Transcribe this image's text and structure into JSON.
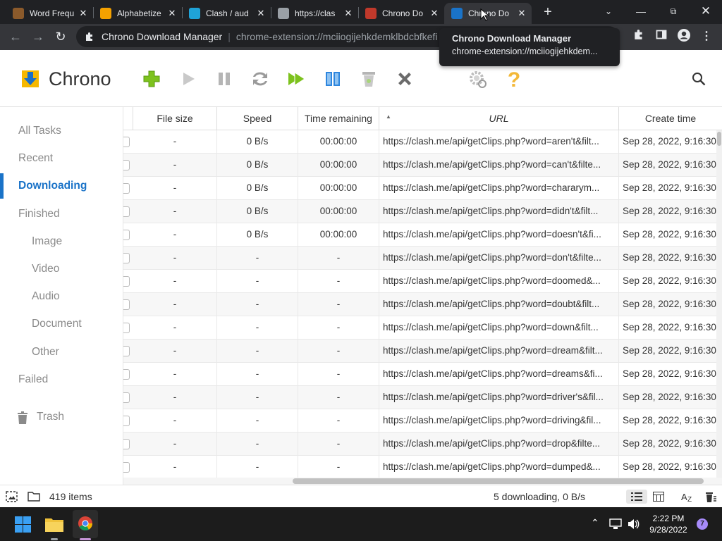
{
  "browser": {
    "tabs": [
      {
        "title": "Word Frequ",
        "icon": "word-frequency-favicon",
        "color": "#8b5a2b"
      },
      {
        "title": "Alphabetize",
        "icon": "alphabetize-favicon",
        "color": "#f4a100"
      },
      {
        "title": "Clash / aud",
        "icon": "clash-favicon",
        "color": "#1fa3d8"
      },
      {
        "title": "https://clas",
        "icon": "globe-favicon",
        "color": "#9aa0a6"
      },
      {
        "title": "Chrono Do",
        "icon": "chrono-favicon-red",
        "color": "#c0392b"
      },
      {
        "title": "Chrono Do",
        "icon": "chrono-favicon",
        "color": "#1a73c8"
      }
    ],
    "new_tab": "+",
    "omnibox": {
      "site": "Chrono Download Manager",
      "url": "chrome-extension://mciiogijehkdemklbdcbfkefi"
    }
  },
  "tooltip": {
    "title": "Chrono Download Manager",
    "url": "chrome-extension://mciiogijehkdem..."
  },
  "app": {
    "title": "Chrono",
    "actions": [
      "add",
      "start",
      "pause",
      "restart",
      "start-all",
      "columns",
      "clean",
      "delete",
      "settings",
      "help"
    ]
  },
  "sidebar": {
    "items": [
      {
        "label": "All Tasks",
        "sub": false,
        "active": false
      },
      {
        "label": "Recent",
        "sub": false,
        "active": false
      },
      {
        "label": "Downloading",
        "sub": false,
        "active": true
      },
      {
        "label": "Finished",
        "sub": false,
        "active": false
      },
      {
        "label": "Image",
        "sub": true,
        "active": false
      },
      {
        "label": "Video",
        "sub": true,
        "active": false
      },
      {
        "label": "Audio",
        "sub": true,
        "active": false
      },
      {
        "label": "Document",
        "sub": true,
        "active": false
      },
      {
        "label": "Other",
        "sub": true,
        "active": false
      },
      {
        "label": "Failed",
        "sub": false,
        "active": false
      }
    ],
    "trash": "Trash"
  },
  "table": {
    "columns": [
      "File size",
      "Speed",
      "Time remaining",
      "URL",
      "Create time"
    ],
    "rows": [
      {
        "size": "-",
        "speed": "0 B/s",
        "remaining": "00:00:00",
        "url": "https://clash.me/api/getClips.php?word=aren't&filt...",
        "created": "Sep 28, 2022, 9:16:30"
      },
      {
        "size": "-",
        "speed": "0 B/s",
        "remaining": "00:00:00",
        "url": "https://clash.me/api/getClips.php?word=can't&filte...",
        "created": "Sep 28, 2022, 9:16:30"
      },
      {
        "size": "-",
        "speed": "0 B/s",
        "remaining": "00:00:00",
        "url": "https://clash.me/api/getClips.php?word=chararym...",
        "created": "Sep 28, 2022, 9:16:30"
      },
      {
        "size": "-",
        "speed": "0 B/s",
        "remaining": "00:00:00",
        "url": "https://clash.me/api/getClips.php?word=didn't&filt...",
        "created": "Sep 28, 2022, 9:16:30"
      },
      {
        "size": "-",
        "speed": "0 B/s",
        "remaining": "00:00:00",
        "url": "https://clash.me/api/getClips.php?word=doesn't&fi...",
        "created": "Sep 28, 2022, 9:16:30"
      },
      {
        "size": "-",
        "speed": "-",
        "remaining": "-",
        "url": "https://clash.me/api/getClips.php?word=don't&filte...",
        "created": "Sep 28, 2022, 9:16:30"
      },
      {
        "size": "-",
        "speed": "-",
        "remaining": "-",
        "url": "https://clash.me/api/getClips.php?word=doomed&...",
        "created": "Sep 28, 2022, 9:16:30"
      },
      {
        "size": "-",
        "speed": "-",
        "remaining": "-",
        "url": "https://clash.me/api/getClips.php?word=doubt&filt...",
        "created": "Sep 28, 2022, 9:16:30"
      },
      {
        "size": "-",
        "speed": "-",
        "remaining": "-",
        "url": "https://clash.me/api/getClips.php?word=down&filt...",
        "created": "Sep 28, 2022, 9:16:30"
      },
      {
        "size": "-",
        "speed": "-",
        "remaining": "-",
        "url": "https://clash.me/api/getClips.php?word=dream&filt...",
        "created": "Sep 28, 2022, 9:16:30"
      },
      {
        "size": "-",
        "speed": "-",
        "remaining": "-",
        "url": "https://clash.me/api/getClips.php?word=dreams&fi...",
        "created": "Sep 28, 2022, 9:16:30"
      },
      {
        "size": "-",
        "speed": "-",
        "remaining": "-",
        "url": "https://clash.me/api/getClips.php?word=driver's&fil...",
        "created": "Sep 28, 2022, 9:16:30"
      },
      {
        "size": "-",
        "speed": "-",
        "remaining": "-",
        "url": "https://clash.me/api/getClips.php?word=driving&fil...",
        "created": "Sep 28, 2022, 9:16:30"
      },
      {
        "size": "-",
        "speed": "-",
        "remaining": "-",
        "url": "https://clash.me/api/getClips.php?word=drop&filte...",
        "created": "Sep 28, 2022, 9:16:30"
      },
      {
        "size": "-",
        "speed": "-",
        "remaining": "-",
        "url": "https://clash.me/api/getClips.php?word=dumped&...",
        "created": "Sep 28, 2022, 9:16:30"
      }
    ]
  },
  "status": {
    "items": "419 items",
    "downloading": "5 downloading, 0 B/s"
  },
  "taskbar": {
    "time": "2:22 PM",
    "date": "9/28/2022",
    "notifications": "7"
  },
  "colors": {
    "accent": "#1a73c8",
    "green": "#7dc21e",
    "toolbar_blue": "#2e86de"
  }
}
